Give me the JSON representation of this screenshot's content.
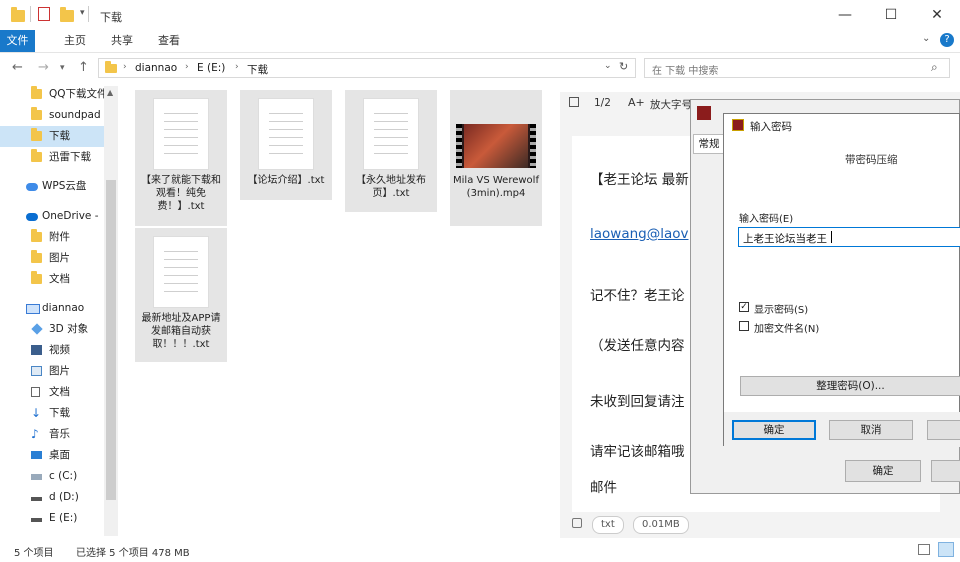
{
  "titlebar": {
    "title": "下载",
    "min": "—",
    "max": "☐",
    "close": "✕"
  },
  "ribbon": {
    "tabs": [
      "文件",
      "主页",
      "共享",
      "查看"
    ]
  },
  "address": {
    "path": [
      "diannao",
      "E (E:)",
      "下载"
    ],
    "search_placeholder": "在 下载 中搜索"
  },
  "nav": {
    "items": [
      {
        "label": "QQ下载文件",
        "icon": "folder-icon"
      },
      {
        "label": "soundpad",
        "icon": "folder-icon"
      },
      {
        "label": "下载",
        "icon": "folder-icon",
        "selected": true
      },
      {
        "label": "迅雷下载",
        "icon": "folder-icon"
      },
      {
        "label": "WPS云盘",
        "icon": "cloud-icon"
      },
      {
        "label": "OneDrive -",
        "icon": "cloud-icon"
      },
      {
        "label": "附件",
        "icon": "folder-icon"
      },
      {
        "label": "图片",
        "icon": "folder-icon"
      },
      {
        "label": "文档",
        "icon": "folder-icon"
      },
      {
        "label": "diannao",
        "icon": "computer-icon"
      },
      {
        "label": "3D 对象",
        "icon": "cube-icon"
      },
      {
        "label": "视频",
        "icon": "video-icon"
      },
      {
        "label": "图片",
        "icon": "picture-icon"
      },
      {
        "label": "文档",
        "icon": "document-icon"
      },
      {
        "label": "下载",
        "icon": "download-icon"
      },
      {
        "label": "音乐",
        "icon": "music-icon"
      },
      {
        "label": "桌面",
        "icon": "desktop-icon"
      },
      {
        "label": "c (C:)",
        "icon": "drive-icon"
      },
      {
        "label": "d (D:)",
        "icon": "drive-icon"
      },
      {
        "label": "E (E:)",
        "icon": "drive-icon"
      }
    ]
  },
  "files": [
    {
      "name": "【来了就能下载和观看！纯免费！】.txt",
      "type": "txt"
    },
    {
      "name": "【论坛介绍】.txt",
      "type": "txt"
    },
    {
      "name": "【永久地址发布页】.txt",
      "type": "txt"
    },
    {
      "name": "Mila VS Werewolf (3min).mp4",
      "type": "video"
    },
    {
      "name": "最新地址及APP请发邮箱自动获取！！！.txt",
      "type": "txt"
    }
  ],
  "status": {
    "count": "5 个项目",
    "selected": "已选择 5 个项目  478 MB"
  },
  "preview": {
    "page": "1/2",
    "font_btn": "放大字号",
    "lines": [
      "【老王论坛 最新",
      "laowang@laov",
      "记不住？老王论",
      "（发送任意内容",
      "未收到回复请注",
      "请牢记该邮箱哦",
      "邮件"
    ],
    "ext": "txt",
    "size": "0.01MB"
  },
  "archive": {
    "tab": "常规",
    "ok": "确定"
  },
  "password": {
    "title": "输入密码",
    "subtitle": "带密码压缩",
    "label": "输入密码(E)",
    "value": "上老王论坛当老王",
    "show_password": "显示密码(S)",
    "encrypt_names": "加密文件名(N)",
    "manage": "整理密码(O)...",
    "ok": "确定",
    "cancel": "取消"
  }
}
